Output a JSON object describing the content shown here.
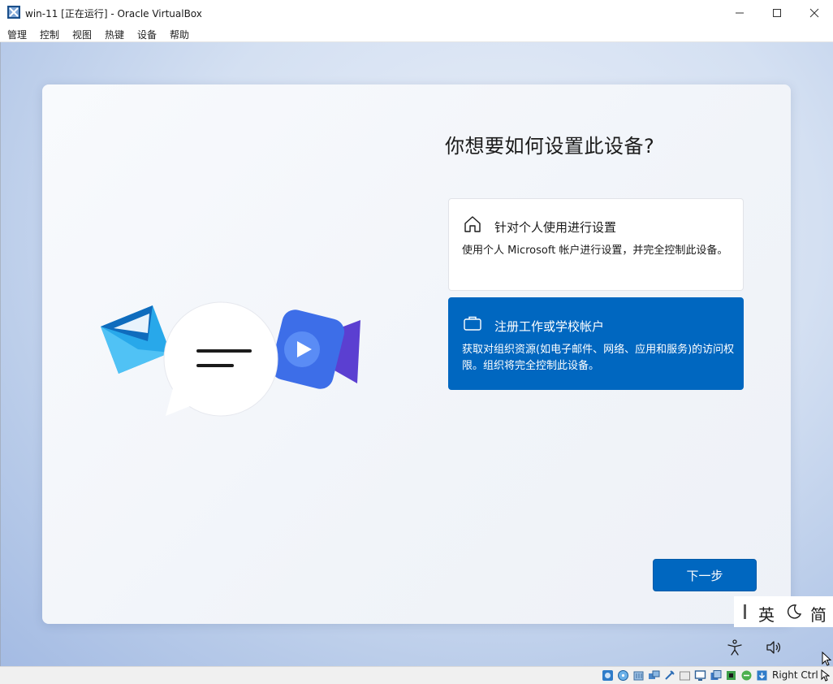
{
  "window": {
    "title": "win-11 [正在运行] - Oracle VirtualBox"
  },
  "menu": {
    "items": [
      "管理",
      "控制",
      "视图",
      "热键",
      "设备",
      "帮助"
    ]
  },
  "oobe": {
    "heading": "你想要如何设置此设备?",
    "options": [
      {
        "icon": "home-icon",
        "title": "针对个人使用进行设置",
        "description": "使用个人 Microsoft 帐户进行设置，并完全控制此设备。",
        "selected": false
      },
      {
        "icon": "briefcase-icon",
        "title": "注册工作或学校帐户",
        "description": "获取对组织资源(如电子邮件、网络、应用和服务)的访问权限。组织将完全控制此设备。",
        "selected": true
      }
    ],
    "next_label": "下一步"
  },
  "ime": {
    "lang": "英",
    "mode": "简"
  },
  "statusbar": {
    "host_key": "Right Ctrl",
    "icons": [
      "hard-disk-icon",
      "optical-drive-icon",
      "audio-icon",
      "network-icon",
      "usb-icon",
      "shared-folder-icon",
      "display-icon",
      "recording-icon",
      "cpu-icon",
      "vt-x-icon",
      "guest-additions-icon",
      "mouse-integration-icon"
    ]
  },
  "colors": {
    "accent": "#0067c0",
    "card_bg": "#f4f6fa",
    "desktop_bg": "#c9d7ee"
  }
}
